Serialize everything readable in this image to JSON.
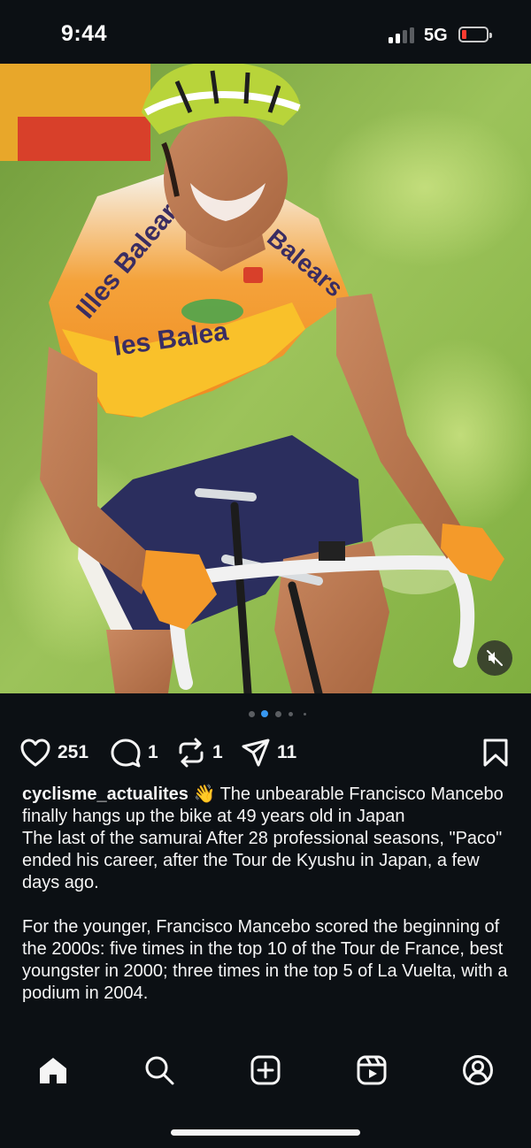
{
  "status_bar": {
    "time": "9:44",
    "network": "5G",
    "signal_bars_active": 2,
    "signal_bars_total": 4,
    "battery_level": 0.1,
    "battery_color": "#ff3b30"
  },
  "post": {
    "image_description_icon": "cyclist-photo",
    "mute_icon": "speaker-muted-icon",
    "carousel": {
      "count": 5,
      "active_index": 1,
      "active_color": "#3797f0"
    },
    "actions": {
      "likes": "251",
      "comments": "1",
      "reposts": "1",
      "shares": "11"
    },
    "caption": {
      "username": "cyclisme_actualites",
      "emoji": "👋",
      "headline": "The unbearable Francisco Mancebo finally hangs up the bike at 49 years old in Japan",
      "paragraph1": "The last of the samurai After 28 professional seasons, \"Paco\" ended his career, after the Tour de Kyushu in Japan, a few days ago.",
      "paragraph2": "For the younger, Francisco Mancebo scored the beginning of the 2000s: five times in the top 10 of the Tour de France, best youngster in 2000; three times in the top 5 of La Vuelta, with a podium in 2004."
    }
  },
  "tabbar": {
    "items": [
      "home-icon",
      "search-icon",
      "create-icon",
      "reels-icon",
      "profile-icon"
    ],
    "active": "home-icon"
  },
  "colors": {
    "background": "#0c1014",
    "text": "#f5f5f5",
    "accent": "#3797f0"
  }
}
